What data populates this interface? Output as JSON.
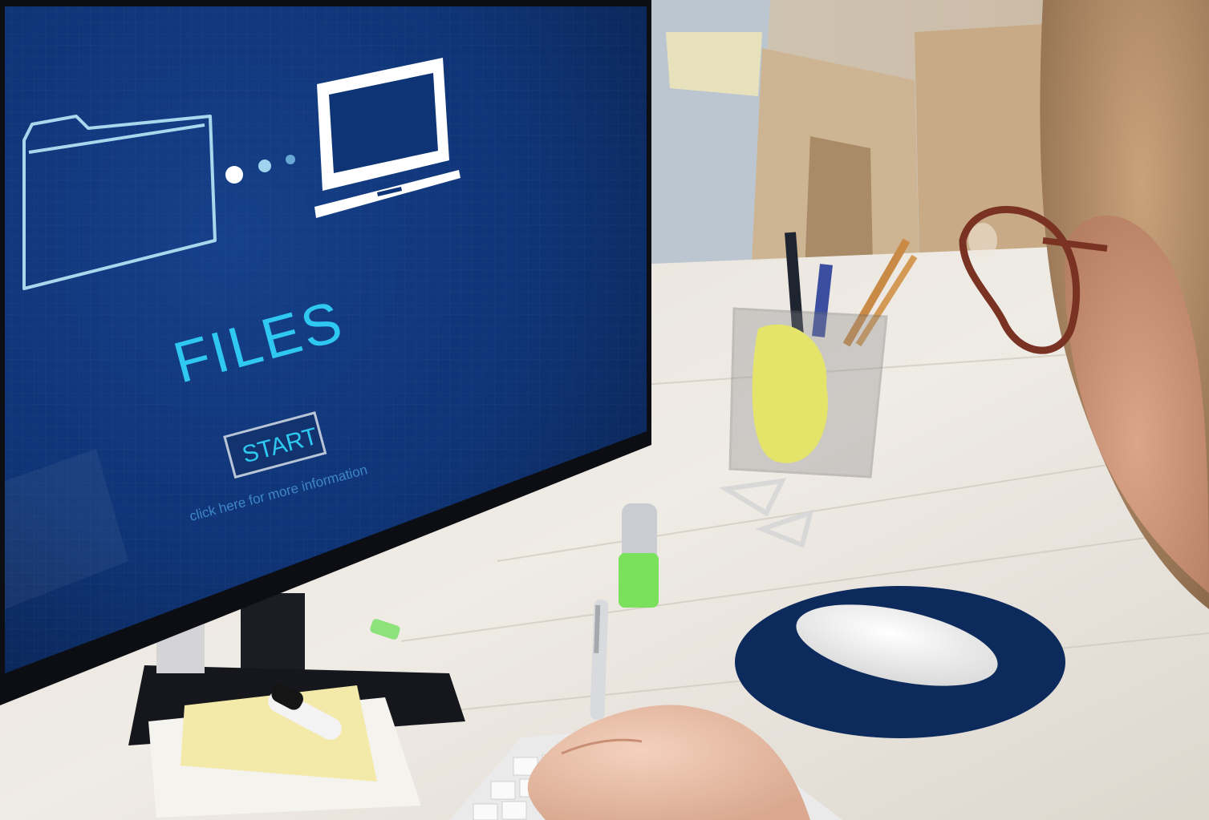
{
  "screen": {
    "title": "FILES",
    "start_button": "START",
    "info_link": "click here for more information",
    "icons": [
      "folder-icon",
      "transfer-dots-icon",
      "laptop-icon"
    ],
    "colors": {
      "screen_bg": "#0f3476",
      "accent": "#2ec8f0",
      "icon_outline": "#a9d8ee",
      "button_border": "#b8c6d8"
    }
  }
}
